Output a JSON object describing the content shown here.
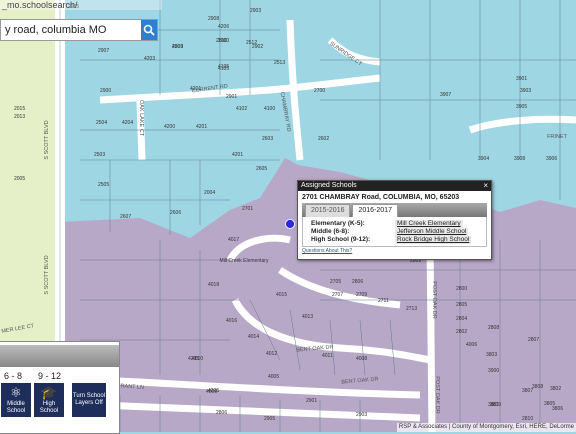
{
  "browser": {
    "url": "_mo.schoolsearch/"
  },
  "search": {
    "value": "y road, columbia MO"
  },
  "colors": {
    "water_zone": "#9fd6e3",
    "purple_zone": "#b8a8c8",
    "green_zone": "#e6f0c8",
    "road": "#ffffff",
    "lines": "#5f7f92"
  },
  "map": {
    "streets": [
      "S SCOTT BLVD",
      "S SCOTT BLVD",
      "CURRENT RD",
      "OAK LAKE CT",
      "SUNRIDGE CT",
      "CHAMBRAY RD",
      "BENT OAK DR",
      "BENT OAK DR",
      "POST OAK DR",
      "POST OAK DR",
      "GRANT LN",
      "FRINET",
      "MER LEE CT",
      "S SCOTT BLVD"
    ],
    "parcel_labels": [
      "2905",
      "2908",
      "2903",
      "4206",
      "4203",
      "2902",
      "2907",
      "2900",
      "2905",
      "2509",
      "2510",
      "2512",
      "4203",
      "4105",
      "2513",
      "4105",
      "4201",
      "2900",
      "2901",
      "4102",
      "4100",
      "2504",
      "4204",
      "4200",
      "4201",
      "2700",
      "2503",
      "4201",
      "2603",
      "2602",
      "2505",
      "2605",
      "2004",
      "2607",
      "2606",
      "2701",
      "4017",
      "2703",
      "2800",
      "2809",
      "2903",
      "4018",
      "4015",
      "2705",
      "2806",
      "2707",
      "2709",
      "2711",
      "2713",
      "4016",
      "4013",
      "2805",
      "4014",
      "2804",
      "4012",
      "4011",
      "2802",
      "4008",
      "2808",
      "2807",
      "4005",
      "4010",
      "4009",
      "2806",
      "4006",
      "3803",
      "3805",
      "3901",
      "3903",
      "3905",
      "3907",
      "3904",
      "3908",
      "3906",
      "3900",
      "3807",
      "2810",
      "3809",
      "3802",
      "3806",
      "3808",
      "3801",
      "2015",
      "2013",
      "2005",
      "4205",
      "4205",
      "2901",
      "2903",
      "2905"
    ],
    "school_label": "Mill Creek Elementary"
  },
  "popup": {
    "title": "Assigned Schools",
    "close_label": "×",
    "address": "2701 CHAMBRAY Road, COLUMBIA, MO, 65203",
    "tabs": [
      {
        "label": "2015-2016"
      },
      {
        "label": "2016-2017"
      }
    ],
    "rows": [
      {
        "label": "Elementary (K-5):",
        "value": "Mill Creek Elementary"
      },
      {
        "label": "Middle (6-8):",
        "value": "Jefferson Middle School"
      },
      {
        "label": "High School (9-12):",
        "value": "Rock Bridge High School"
      }
    ],
    "questions_link": "Questions About This?"
  },
  "legend": {
    "grades": [
      "6 - 8",
      "9 - 12"
    ],
    "buttons": [
      {
        "label": "Middle School",
        "icon": "atom-icon"
      },
      {
        "label": "High School",
        "icon": "graduation-cap-icon"
      },
      {
        "label": "Turn School Layers Off",
        "icon": "none"
      }
    ]
  },
  "attribution": "RSP & Associates | County of Montgomery, Esri, HERE, DeLorme"
}
